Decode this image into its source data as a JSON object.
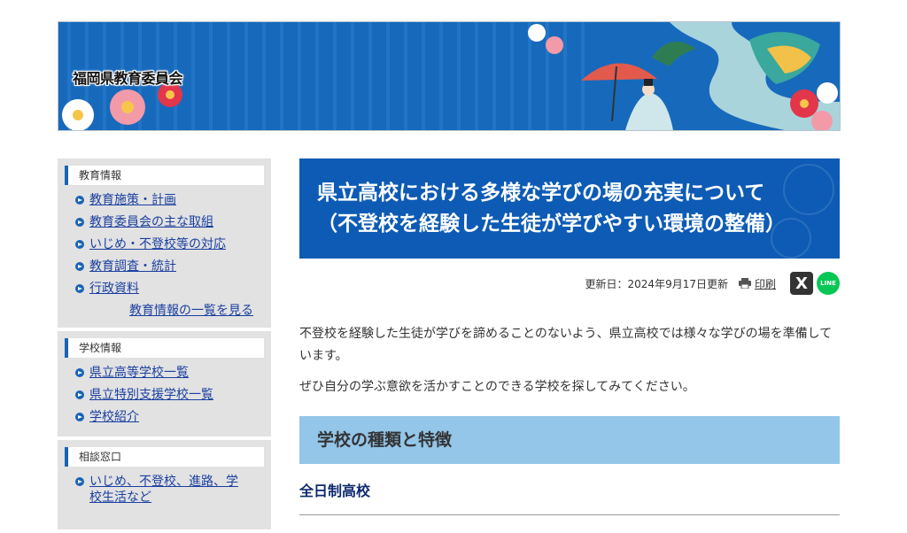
{
  "banner": {
    "title": "福岡県教育委員会"
  },
  "sidebar": {
    "sections": [
      {
        "heading": "教育情報",
        "items": [
          "教育施策・計画",
          "教育委員会の主な取組",
          "いじめ・不登校等の対応",
          "教育調査・統計",
          "行政資料"
        ],
        "more": "教育情報の一覧を見る"
      },
      {
        "heading": "学校情報",
        "items": [
          "県立高等学校一覧",
          "県立特別支援学校一覧",
          "学校紹介"
        ]
      },
      {
        "heading": "相談窓口",
        "items": [
          "いじめ、不登校、進路、学校生活など"
        ]
      }
    ]
  },
  "main": {
    "title_line1": "県立高校における多様な学びの場の充実について",
    "title_line2": "（不登校を経験した生徒が学びやすい環境の整備）",
    "updated": "更新日：2024年9月17日更新",
    "print_label": "印刷",
    "share_x": "X",
    "share_line": "LINE",
    "paragraphs": [
      "不登校を経験した生徒が学びを諦めることのないよう、県立高校では様々な学びの場を準備しています。",
      "ぜひ自分の学ぶ意欲を活かすことのできる学校を探してみてください。"
    ],
    "section_heading": "学校の種類と特徴",
    "subheading": "全日制高校"
  },
  "colors": {
    "accent": "#0d5bb5",
    "heading_bg": "#93c6e8",
    "sidebar_bg": "#e2e2e2"
  }
}
